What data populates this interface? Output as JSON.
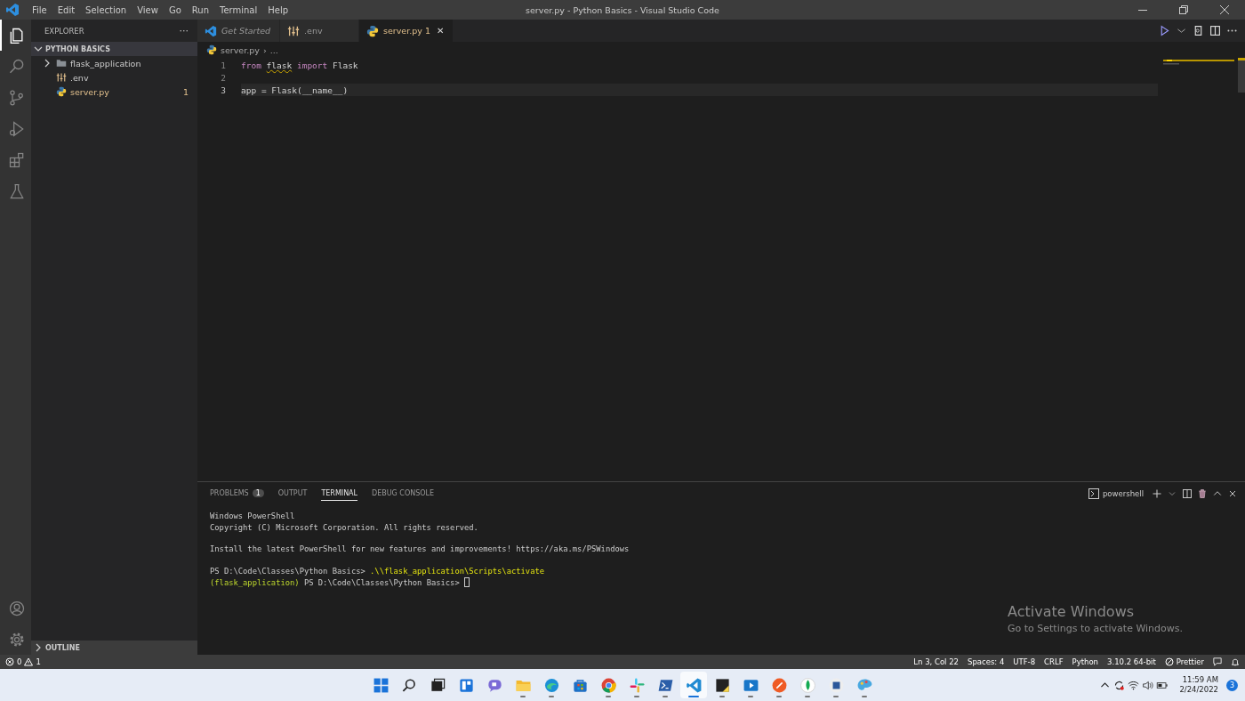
{
  "window": {
    "title": "server.py - Python Basics - Visual Studio Code"
  },
  "menu": [
    "File",
    "Edit",
    "Selection",
    "View",
    "Go",
    "Run",
    "Terminal",
    "Help"
  ],
  "activity_bar": [
    {
      "kind": "files",
      "selected": true
    },
    {
      "kind": "search",
      "selected": false
    },
    {
      "kind": "scm",
      "selected": false
    },
    {
      "kind": "debug",
      "selected": false
    },
    {
      "kind": "extensions",
      "selected": false
    },
    {
      "kind": "testing",
      "selected": false
    }
  ],
  "activity_bottom": [
    {
      "kind": "account"
    },
    {
      "kind": "settings"
    }
  ],
  "sidebar": {
    "title": "EXPLORER",
    "more": "···",
    "section": {
      "title": "PYTHON BASICS",
      "expanded": true,
      "items": [
        {
          "kind": "folder",
          "label": "flask_application",
          "expanded": false,
          "modified": false
        },
        {
          "kind": "env",
          "label": ".env",
          "modified": false
        },
        {
          "kind": "python",
          "label": "server.py",
          "modified": true,
          "badge": "1"
        }
      ]
    },
    "outline": {
      "title": "OUTLINE",
      "expanded": false
    }
  },
  "tabs": [
    {
      "kind": "vscode",
      "label": "Get Started",
      "italic": true,
      "selected": false
    },
    {
      "kind": "env",
      "label": ".env",
      "italic": false,
      "selected": false
    },
    {
      "kind": "python",
      "label": "server.py",
      "badge": "1",
      "italic": false,
      "selected": true,
      "close": "✕"
    }
  ],
  "breadcrumb": {
    "file": "server.py",
    "sep": "›",
    "rest": "..."
  },
  "code": [
    {
      "number": "1",
      "current": false,
      "tokens": [
        {
          "kind": "keyword",
          "text": "from "
        },
        {
          "kind": "warn",
          "text": "flask"
        },
        {
          "kind": "keyword",
          "text": " import"
        },
        {
          "kind": "plain",
          "text": " Flask"
        }
      ]
    },
    {
      "number": "2",
      "current": false
    },
    {
      "number": "3",
      "current": true,
      "tokens": [
        {
          "kind": "plain",
          "text": "app = Flask("
        },
        {
          "kind": "plain",
          "text": "__name__"
        },
        {
          "kind": "plain",
          "text": ")"
        }
      ]
    }
  ],
  "panel": {
    "tabs": [
      {
        "label": "PROBLEMS",
        "badge": "1",
        "selected": false
      },
      {
        "label": "OUTPUT",
        "selected": false
      },
      {
        "label": "TERMINAL",
        "selected": true
      },
      {
        "label": "DEBUG CONSOLE",
        "selected": false
      }
    ],
    "shell": "powershell",
    "terminal": [
      {
        "lines": [
          [
            {
              "kind": "plain",
              "text": "Windows PowerShell"
            }
          ],
          [
            {
              "kind": "plain",
              "text": "Copyright (C) Microsoft Corporation. All rights reserved."
            }
          ]
        ]
      },
      {
        "lines": [
          [
            {
              "kind": "plain",
              "text": "Install the latest PowerShell for new features and improvements! https://aka.ms/PSWindows"
            }
          ]
        ]
      },
      {
        "lines": [
          [
            {
              "kind": "plain",
              "text": "PS D:\\Code\\Classes\\Python Basics> "
            },
            {
              "kind": "command",
              "text": ".\\\\flask_application\\Scripts\\activate"
            }
          ],
          [
            {
              "kind": "env",
              "text": "(flask_application)"
            },
            {
              "kind": "plain",
              "text": " PS D:\\Code\\Classes\\Python Basics> "
            },
            {
              "kind": "cursor"
            }
          ]
        ]
      }
    ]
  },
  "activation": {
    "title": "Activate Windows",
    "subtitle": "Go to Settings to activate Windows."
  },
  "status_bar": {
    "errors": "0",
    "warnings": "1",
    "right": [
      "Ln 3, Col 22",
      "Spaces: 4",
      "UTF-8",
      "CRLF",
      "Python",
      "3.10.2 64-bit",
      "Prettier"
    ]
  },
  "taskbar": {
    "apps": [
      {
        "kind": "start",
        "running": false,
        "selected": false
      },
      {
        "kind": "search",
        "running": false,
        "selected": false
      },
      {
        "kind": "taskview",
        "running": false,
        "selected": false
      },
      {
        "kind": "widgets",
        "running": false,
        "selected": false
      },
      {
        "kind": "chat",
        "running": false,
        "selected": false
      },
      {
        "kind": "folder",
        "running": true,
        "selected": false
      },
      {
        "kind": "edge",
        "running": true,
        "selected": false
      },
      {
        "kind": "store",
        "running": false,
        "selected": false
      },
      {
        "kind": "chrome",
        "running": true,
        "selected": false
      },
      {
        "kind": "slack",
        "running": true,
        "selected": false
      },
      {
        "kind": "terminal",
        "running": true,
        "selected": false
      },
      {
        "kind": "vscode",
        "running": true,
        "selected": true
      },
      {
        "kind": "notes",
        "running": true,
        "selected": false
      },
      {
        "kind": "media",
        "running": true,
        "selected": false
      },
      {
        "kind": "postman",
        "running": true,
        "selected": false
      },
      {
        "kind": "mongo",
        "running": true,
        "selected": false
      },
      {
        "kind": "word",
        "running": true,
        "selected": false
      },
      {
        "kind": "paint",
        "running": true,
        "selected": false
      }
    ],
    "time": "11:59 AM",
    "date": "2/24/2022",
    "notifications": "3"
  }
}
